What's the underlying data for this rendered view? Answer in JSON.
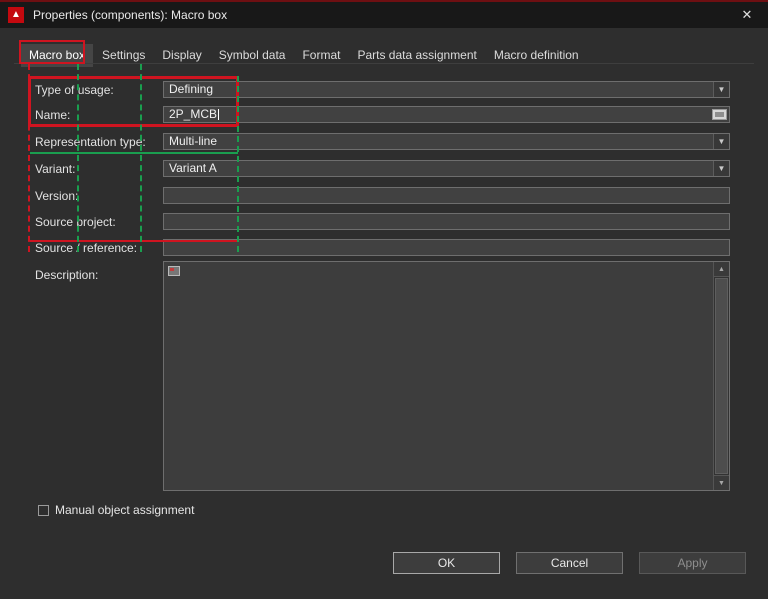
{
  "window": {
    "title": "Properties (components): Macro box",
    "close": "✕"
  },
  "tabs": [
    {
      "label": "Macro box",
      "active": true
    },
    {
      "label": "Settings",
      "active": false
    },
    {
      "label": "Display",
      "active": false
    },
    {
      "label": "Symbol data",
      "active": false
    },
    {
      "label": "Format",
      "active": false
    },
    {
      "label": "Parts data assignment",
      "active": false
    },
    {
      "label": "Macro definition",
      "active": false
    }
  ],
  "form": {
    "type_of_usage": {
      "label": "Type of usage:",
      "value": "Defining"
    },
    "name": {
      "label": "Name:",
      "value": "2P_MCB"
    },
    "representation_type": {
      "label": "Representation type:",
      "value": "Multi-line"
    },
    "variant": {
      "label": "Variant:",
      "value": "Variant A"
    },
    "version": {
      "label": "Version:",
      "value": ""
    },
    "source_project": {
      "label": "Source project:",
      "value": ""
    },
    "source_reference": {
      "label": "Source / reference:",
      "value": ""
    },
    "description": {
      "label": "Description:",
      "value": ""
    }
  },
  "checkbox": {
    "label": "Manual object assignment",
    "checked": false
  },
  "buttons": {
    "ok": "OK",
    "cancel": "Cancel",
    "apply": "Apply"
  },
  "colors": {
    "annotation_red": "#cf1420",
    "annotation_green": "#1a9e4f",
    "dialog_background": "#2e2e2e",
    "titlebar_background": "#181818",
    "field_background": "#414141",
    "logo_red": "#c4090f"
  }
}
